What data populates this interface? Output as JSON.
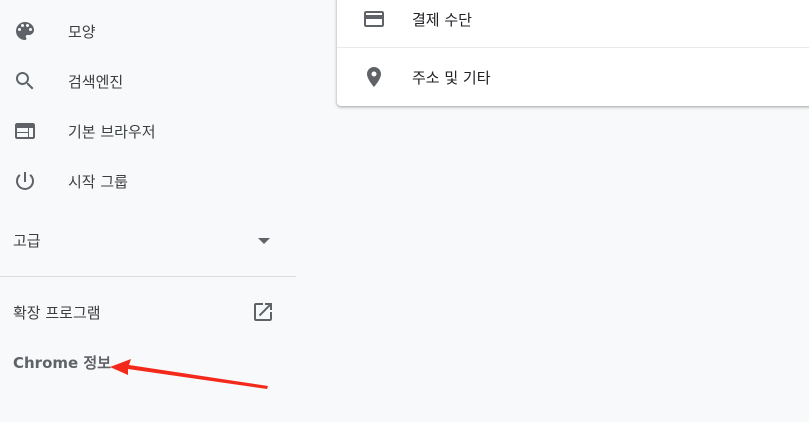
{
  "sidebar": {
    "items": [
      {
        "label": "모양",
        "icon": "palette-icon"
      },
      {
        "label": "검색엔진",
        "icon": "search-icon"
      },
      {
        "label": "기본 브라우저",
        "icon": "browser-icon"
      },
      {
        "label": "시작 그룹",
        "icon": "power-icon"
      }
    ],
    "advanced_label": "고급",
    "extensions_label": "확장 프로그램",
    "about_label": "Chrome 정보"
  },
  "card": {
    "rows": [
      {
        "label": "결제 수단",
        "icon": "credit-card-icon"
      },
      {
        "label": "주소 및 기타",
        "icon": "location-pin-icon"
      }
    ]
  },
  "colors": {
    "icon": "#5f6368",
    "annotation_arrow": "#f2291b",
    "background": "#f8f9fa"
  }
}
